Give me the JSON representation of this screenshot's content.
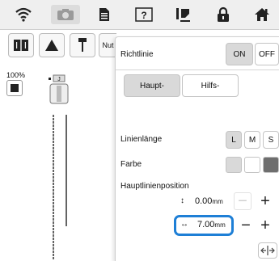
{
  "toolbar": {
    "icons": [
      "wifi-icon",
      "camera-icon",
      "document-icon",
      "help-icon",
      "sew-icon",
      "lock-icon",
      "home-icon"
    ]
  },
  "left": {
    "zoom": "100%",
    "tool_label": "Nut"
  },
  "panel": {
    "title": "Richtlinie",
    "on_label": "ON",
    "off_label": "OFF",
    "tab_main": "Haupt-",
    "tab_aux": "Hilfs-",
    "line_length_label": "Linienlänge",
    "length_options": [
      "L",
      "M",
      "S"
    ],
    "color_label": "Farbe",
    "position_label": "Hauptlinienposition",
    "vertical_value": "0.00",
    "horizontal_value": "7.00",
    "unit": "mm",
    "highlight_color": "#1e7fd6"
  }
}
